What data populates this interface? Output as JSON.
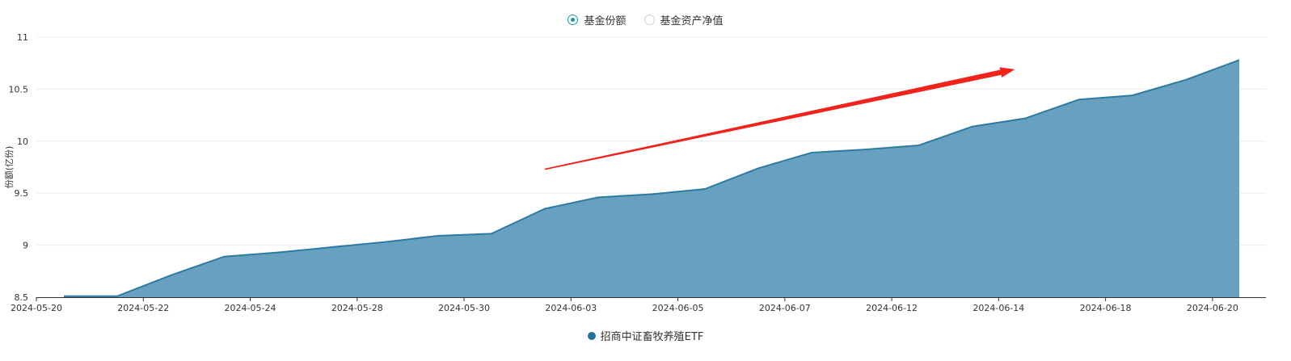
{
  "toggles": [
    {
      "label": "基金份额",
      "selected": true
    },
    {
      "label": "基金资产净值",
      "selected": false
    }
  ],
  "colors": {
    "area_fill": "#67a1bf",
    "area_line": "#2d7aa3",
    "legend_dot": "#2271a0",
    "arrow": "#f2231b",
    "radio_on": "#1a9aa0"
  },
  "chart_data": {
    "type": "area",
    "ylabel": "份额(亿份)",
    "ylim": [
      8.5,
      11
    ],
    "yticks": [
      8.5,
      9,
      9.5,
      10,
      10.5,
      11
    ],
    "x_tick_labels": [
      "2024-05-20",
      "2024-05-22",
      "2024-05-24",
      "2024-05-28",
      "2024-05-30",
      "2024-06-03",
      "2024-06-05",
      "2024-06-07",
      "2024-06-12",
      "2024-06-14",
      "2024-06-18",
      "2024-06-20"
    ],
    "series": [
      {
        "name": "招商中证畜牧养殖ETF",
        "values": [
          8.51,
          8.51,
          8.71,
          8.89,
          8.93,
          8.98,
          9.03,
          9.09,
          9.11,
          9.35,
          9.46,
          9.49,
          9.54,
          9.74,
          9.89,
          9.92,
          9.96,
          10.14,
          10.22,
          10.4,
          10.44,
          10.59,
          10.78
        ]
      }
    ],
    "annotation": {
      "type": "trend-arrow",
      "from": [
        9.0,
        9.73
      ],
      "to": [
        17.8,
        10.69
      ]
    }
  }
}
